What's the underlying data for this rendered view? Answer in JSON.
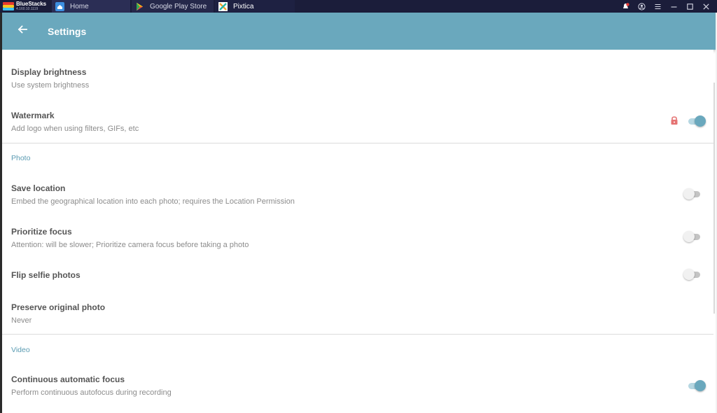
{
  "window": {
    "brand_name": "BlueStacks",
    "brand_version": "4.160.10.1119",
    "tabs": [
      {
        "label": "Home",
        "icon": "home-icon"
      },
      {
        "label": "Google Play Store",
        "icon": "play-store-icon"
      },
      {
        "label": "Pixtica",
        "icon": "pixtica-app-icon"
      }
    ],
    "controls": [
      "notification-icon",
      "account-icon",
      "menu-icon",
      "minimize-icon",
      "maximize-icon",
      "close-icon"
    ]
  },
  "appbar": {
    "title": "Settings",
    "color": "#6aa8bd"
  },
  "settings": {
    "display_brightness": {
      "title": "Display brightness",
      "subtitle": "Use system brightness"
    },
    "watermark": {
      "title": "Watermark",
      "subtitle": "Add logo when using filters, GIFs, etc",
      "locked": true,
      "enabled": true
    },
    "photo_section": "Photo",
    "save_location": {
      "title": "Save location",
      "subtitle": "Embed the geographical location into each photo; requires the Location Permission",
      "enabled": false
    },
    "prioritize_focus": {
      "title": "Prioritize focus",
      "subtitle": "Attention: will be slower; Prioritize camera focus before taking a photo",
      "enabled": false
    },
    "flip_selfie": {
      "title": "Flip selfie photos",
      "enabled": false
    },
    "preserve_original": {
      "title": "Preserve original photo",
      "subtitle": "Never"
    },
    "video_section": "Video",
    "continuous_focus": {
      "title": "Continuous automatic focus",
      "subtitle": "Perform continuous autofocus during recording",
      "enabled": true
    }
  },
  "colors": {
    "accent": "#6aa8bd",
    "lock": "#e57373",
    "section": "#5a9bb2"
  }
}
